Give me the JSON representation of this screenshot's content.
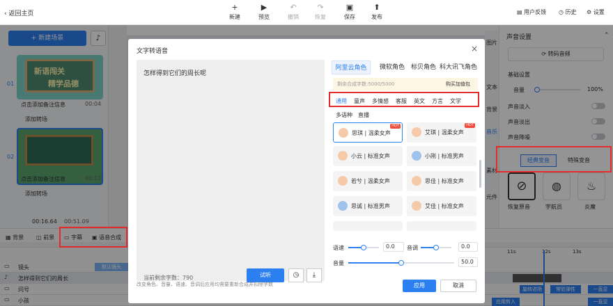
{
  "topbar": {
    "back": "返回主页",
    "buttons": [
      {
        "label": "新建",
        "icon": "+"
      },
      {
        "label": "预览",
        "icon": "▶"
      },
      {
        "label": "撤销",
        "icon": "↶"
      },
      {
        "label": "恢复",
        "icon": "↷"
      },
      {
        "label": "保存",
        "icon": "▣"
      },
      {
        "label": "发布",
        "icon": "⬆"
      }
    ],
    "feedback": "用户反馈",
    "history": "历史",
    "settings": "设置"
  },
  "left": {
    "new_scene": "+ 新建场景",
    "scenes": [
      {
        "num": "01",
        "note": "点击添加备注信息",
        "time": "00:04",
        "trans": "添加转场",
        "title1": "新语闯关",
        "title2": "精学品德"
      },
      {
        "num": "02",
        "note": "点击添加备注信息",
        "time": "00:13",
        "trans": "添加转场"
      }
    ],
    "time_current": "00:16.64",
    "time_total": "00:51.09"
  },
  "bottom_tools": [
    {
      "label": "背景"
    },
    {
      "label": "前景"
    },
    {
      "label": "字幕"
    },
    {
      "label": "语音合成"
    }
  ],
  "tracks": [
    "镜头",
    "怎样得到它们的周长",
    "问号",
    "小孩"
  ],
  "timeline": {
    "ticks": [
      "11s",
      "12s",
      "13s"
    ],
    "clip_label": "默认镜头",
    "right_labels": [
      "旋转进场",
      "常驻弹性",
      "一直显",
      "应用剪入",
      "一直显"
    ]
  },
  "right_panel": {
    "title": "声音设置",
    "convert": "转码音频",
    "basic": "基础设置",
    "volume_label": "音量",
    "volume_value": "100%",
    "fade_in": "声音淡入",
    "fade_out": "声音淡出",
    "loop": "声音降噪",
    "tab_classic": "经典变音",
    "tab_special": "特殊变音",
    "effects": [
      "恢复原音",
      "宇航员",
      "炎魔"
    ],
    "side_tags": [
      "图片",
      "文本",
      "背景",
      "音乐",
      "素材",
      "元件"
    ]
  },
  "modal": {
    "title": "文字转语音",
    "text": "怎样得到它们的周长呢",
    "remaining": "当前剩余字数：790",
    "try_btn": "试听",
    "hint": "改变角色、音量、语速、音调后应用均需要重新合成并扣除字数",
    "apply": "应用",
    "cancel": "取消",
    "provider_tabs": [
      "阿里云角色",
      "微软角色",
      "标贝角色",
      "科大讯飞角色"
    ],
    "quota": "剩余合成字数:5000/5000",
    "buy": "购买加值包",
    "categories": [
      "通用",
      "童声",
      "多情感",
      "客服",
      "英文",
      "方言",
      "文学"
    ],
    "categories2": [
      "多语种",
      "直播"
    ],
    "voices": [
      {
        "name": "思琪 | 温柔女声",
        "hot": "HOT",
        "gender": "f"
      },
      {
        "name": "艾琪 | 温柔女声",
        "hot": "HOT",
        "gender": "f"
      },
      {
        "name": "小云 | 标准女声",
        "gender": "f"
      },
      {
        "name": "小刚 | 标准男声",
        "gender": "m"
      },
      {
        "name": "若兮 | 温柔女声",
        "gender": "f"
      },
      {
        "name": "思佳 | 标准女声",
        "gender": "f"
      },
      {
        "name": "思诚 | 标准男声",
        "gender": "m"
      },
      {
        "name": "艾佳 | 标准女声",
        "gender": "f"
      }
    ],
    "speed_label": "语速",
    "speed_value": "0.0",
    "pitch_label": "音调",
    "pitch_value": "0.0",
    "volume_label": "音量",
    "volume_value": "50.0"
  },
  "colors": {
    "accent": "#2b7ff0",
    "highlight": "#e42b2b",
    "hot": "#f04b3b"
  }
}
